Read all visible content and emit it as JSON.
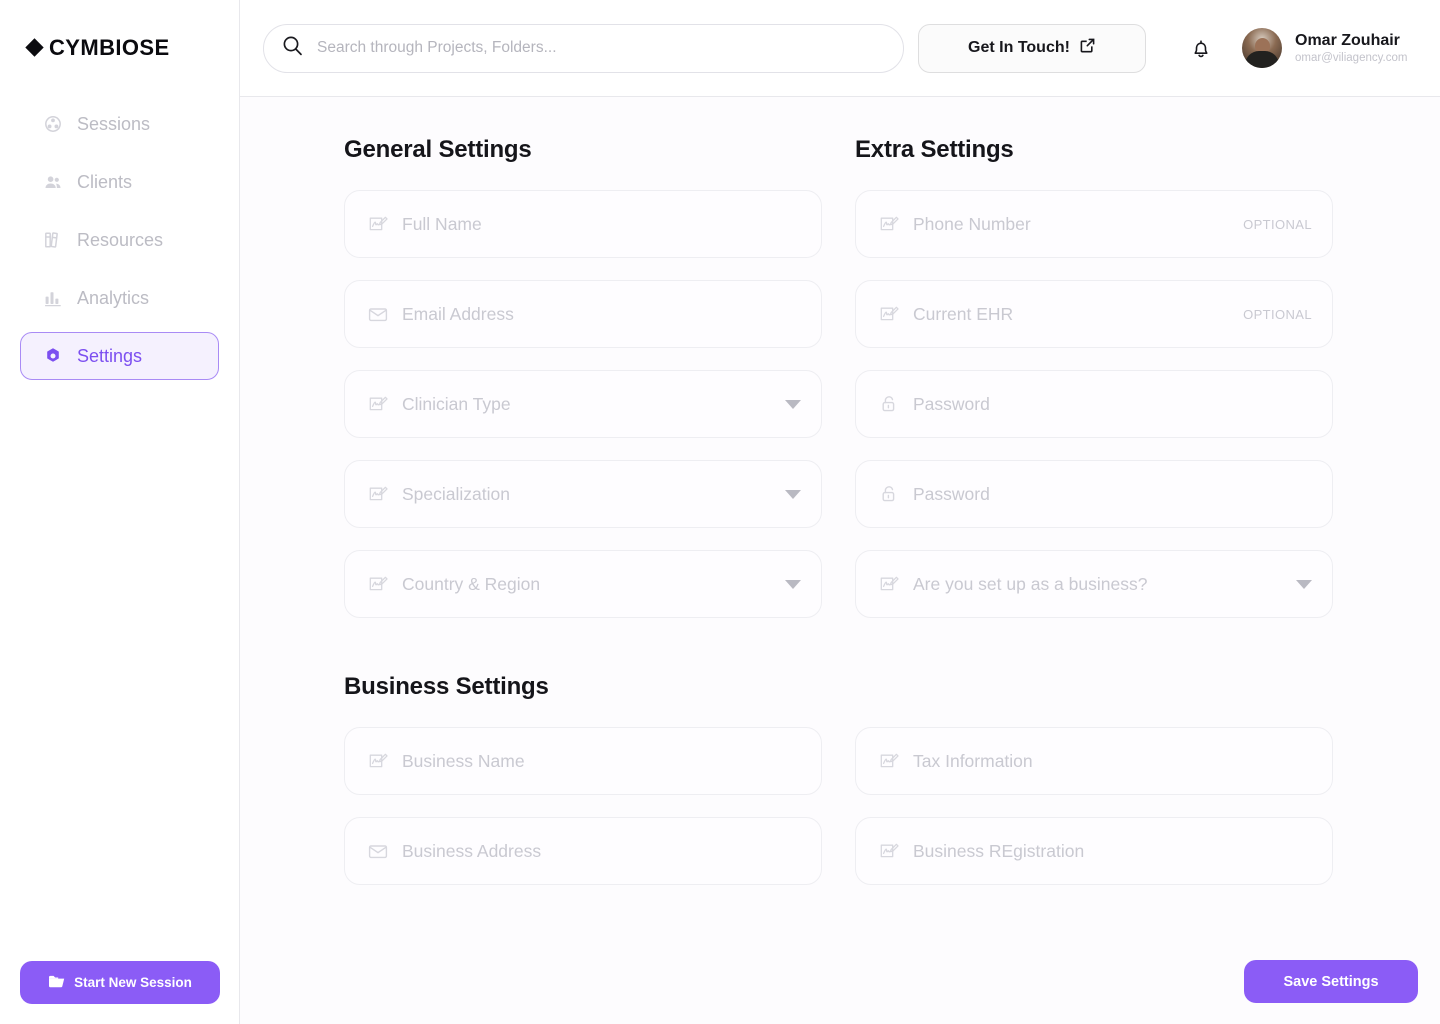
{
  "brand": {
    "name": "CYMBIOSE",
    "logo_icon": "diamond-icon",
    "accent_color": "#8b5cf6",
    "active_nav_text_color": "#7c4ff0",
    "active_nav_bg_color": "#f5f1fe"
  },
  "sidebar": {
    "items": [
      {
        "label": "Sessions",
        "icon": "network-share-icon",
        "active": false
      },
      {
        "label": "Clients",
        "icon": "users-group-icon",
        "active": false
      },
      {
        "label": "Resources",
        "icon": "books-icon",
        "active": false
      },
      {
        "label": "Analytics",
        "icon": "bar-chart-icon",
        "active": false
      },
      {
        "label": "Settings",
        "icon": "gear-icon",
        "active": true
      }
    ],
    "start_session_button": {
      "label": "Start New Session",
      "icon": "folder-icon"
    }
  },
  "header": {
    "search": {
      "placeholder": "Search through Projects, Folders...",
      "value": "",
      "icon": "search-icon"
    },
    "cta": {
      "label": "Get In Touch!",
      "icon": "external-link-icon"
    },
    "notifications_icon": "bell-icon",
    "user": {
      "name": "Omar Zouhair",
      "email": "omar@viliagency.com",
      "avatar": "avatar"
    }
  },
  "main": {
    "sections": [
      {
        "id": "general",
        "title": "General Settings",
        "fields": [
          {
            "placeholder": "Full Name",
            "value": "",
            "icon": "signature-icon",
            "type": "text",
            "optional": false
          },
          {
            "placeholder": "Email Address",
            "value": "",
            "icon": "envelope-icon",
            "type": "email",
            "optional": false
          },
          {
            "placeholder": "Clinician Type",
            "value": "",
            "icon": "signature-icon",
            "type": "dropdown",
            "optional": false
          },
          {
            "placeholder": "Specialization",
            "value": "",
            "icon": "signature-icon",
            "type": "dropdown",
            "optional": false
          },
          {
            "placeholder": "Country & Region",
            "value": "",
            "icon": "signature-icon",
            "type": "dropdown",
            "optional": false
          }
        ]
      },
      {
        "id": "extra",
        "title": "Extra Settings",
        "fields": [
          {
            "placeholder": "Phone Number",
            "value": "",
            "icon": "signature-icon",
            "type": "text",
            "optional": true,
            "optional_label": "OPTIONAL"
          },
          {
            "placeholder": "Current EHR",
            "value": "",
            "icon": "signature-icon",
            "type": "text",
            "optional": true,
            "optional_label": "OPTIONAL"
          },
          {
            "placeholder": "Password",
            "value": "",
            "icon": "lock-icon",
            "type": "password",
            "optional": false
          },
          {
            "placeholder": "Password",
            "value": "",
            "icon": "lock-icon",
            "type": "password",
            "optional": false
          },
          {
            "placeholder": "Are you set up as a business?",
            "value": "",
            "icon": "signature-icon",
            "type": "dropdown",
            "optional": false
          }
        ]
      },
      {
        "id": "business",
        "title": "Business Settings",
        "fields_left": [
          {
            "placeholder": "Business Name",
            "value": "",
            "icon": "signature-icon",
            "type": "text"
          },
          {
            "placeholder": "Business Address",
            "value": "",
            "icon": "envelope-icon",
            "type": "text"
          }
        ],
        "fields_right": [
          {
            "placeholder": "Tax Information",
            "value": "",
            "icon": "signature-icon",
            "type": "text"
          },
          {
            "placeholder": "Business REgistration",
            "value": "",
            "icon": "signature-icon",
            "type": "text"
          }
        ]
      }
    ],
    "save_button": {
      "label": "Save Settings"
    }
  }
}
